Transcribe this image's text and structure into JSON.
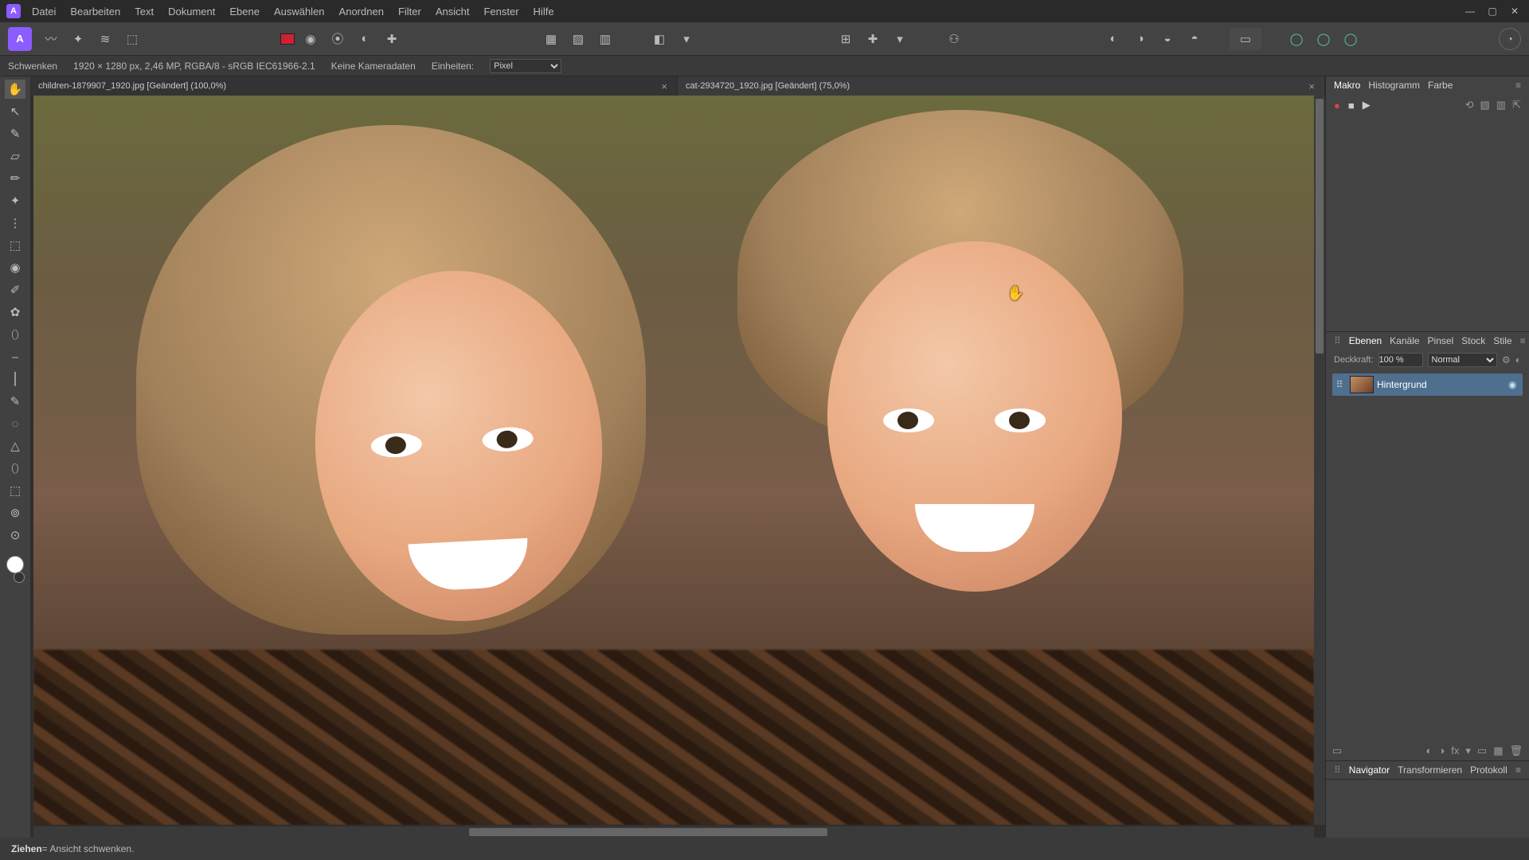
{
  "menu": {
    "items": [
      "Datei",
      "Bearbeiten",
      "Text",
      "Dokument",
      "Ebene",
      "Auswählen",
      "Anordnen",
      "Filter",
      "Ansicht",
      "Fenster",
      "Hilfe"
    ]
  },
  "context": {
    "tool": "Schwenken",
    "docinfo": "1920 × 1280 px, 2,46 MP, RGBA/8 - sRGB IEC61966-2.1",
    "camera": "Keine Kameradaten",
    "units_label": "Einheiten:",
    "units_value": "Pixel"
  },
  "tabs": [
    {
      "label": "children-1879907_1920.jpg [Geändert] (100,0%)",
      "active": true
    },
    {
      "label": "cat-2934720_1920.jpg [Geändert] (75,0%)",
      "active": false
    }
  ],
  "panels": {
    "top": {
      "tabs": [
        "Makro",
        "Histogramm",
        "Farbe"
      ],
      "active": "Makro"
    },
    "layers": {
      "tabs": [
        "Ebenen",
        "Kanäle",
        "Pinsel",
        "Stock",
        "Stile"
      ],
      "active": "Ebenen",
      "opacity_label": "Deckkraft:",
      "opacity_value": "100 %",
      "blend_mode": "Normal",
      "rows": [
        {
          "name": "Hintergrund"
        }
      ]
    },
    "bottom": {
      "tabs": [
        "Navigator",
        "Transformieren",
        "Protokoll"
      ],
      "active": "Navigator"
    }
  },
  "status": {
    "action": "Ziehen",
    "hint": " = Ansicht schwenken."
  },
  "icons": {
    "app": "A",
    "toolbar": [
      "〰",
      "✦",
      "≋",
      "⬚"
    ],
    "toolbar_mid1": [
      "◉",
      "⦿",
      "◐",
      "✚"
    ],
    "toolbar_mid2": [
      "▦",
      "▨",
      "▥"
    ],
    "toolbar_mid3": [
      "◧",
      "▾"
    ],
    "toolbar_mid4": [
      "⊞",
      "✚",
      "▾"
    ],
    "toolbar_mid5": [
      "⚇"
    ],
    "toolbar_right1": [
      "◐",
      "◑",
      "◒",
      "◓"
    ],
    "toolbar_right2": [
      "▭"
    ],
    "toolbar_right3": [
      "◯",
      "◯",
      "◯"
    ],
    "account": "◔"
  },
  "tools": [
    "✋",
    "↖",
    "✎",
    "▱",
    "✏",
    "✦",
    "⋮",
    "⬚",
    "◉",
    "✐",
    "✿",
    "⬯",
    "⎯",
    "⎮",
    "✎",
    "◌",
    "△",
    "⬯",
    "⬚",
    "⊚",
    "⊙"
  ]
}
